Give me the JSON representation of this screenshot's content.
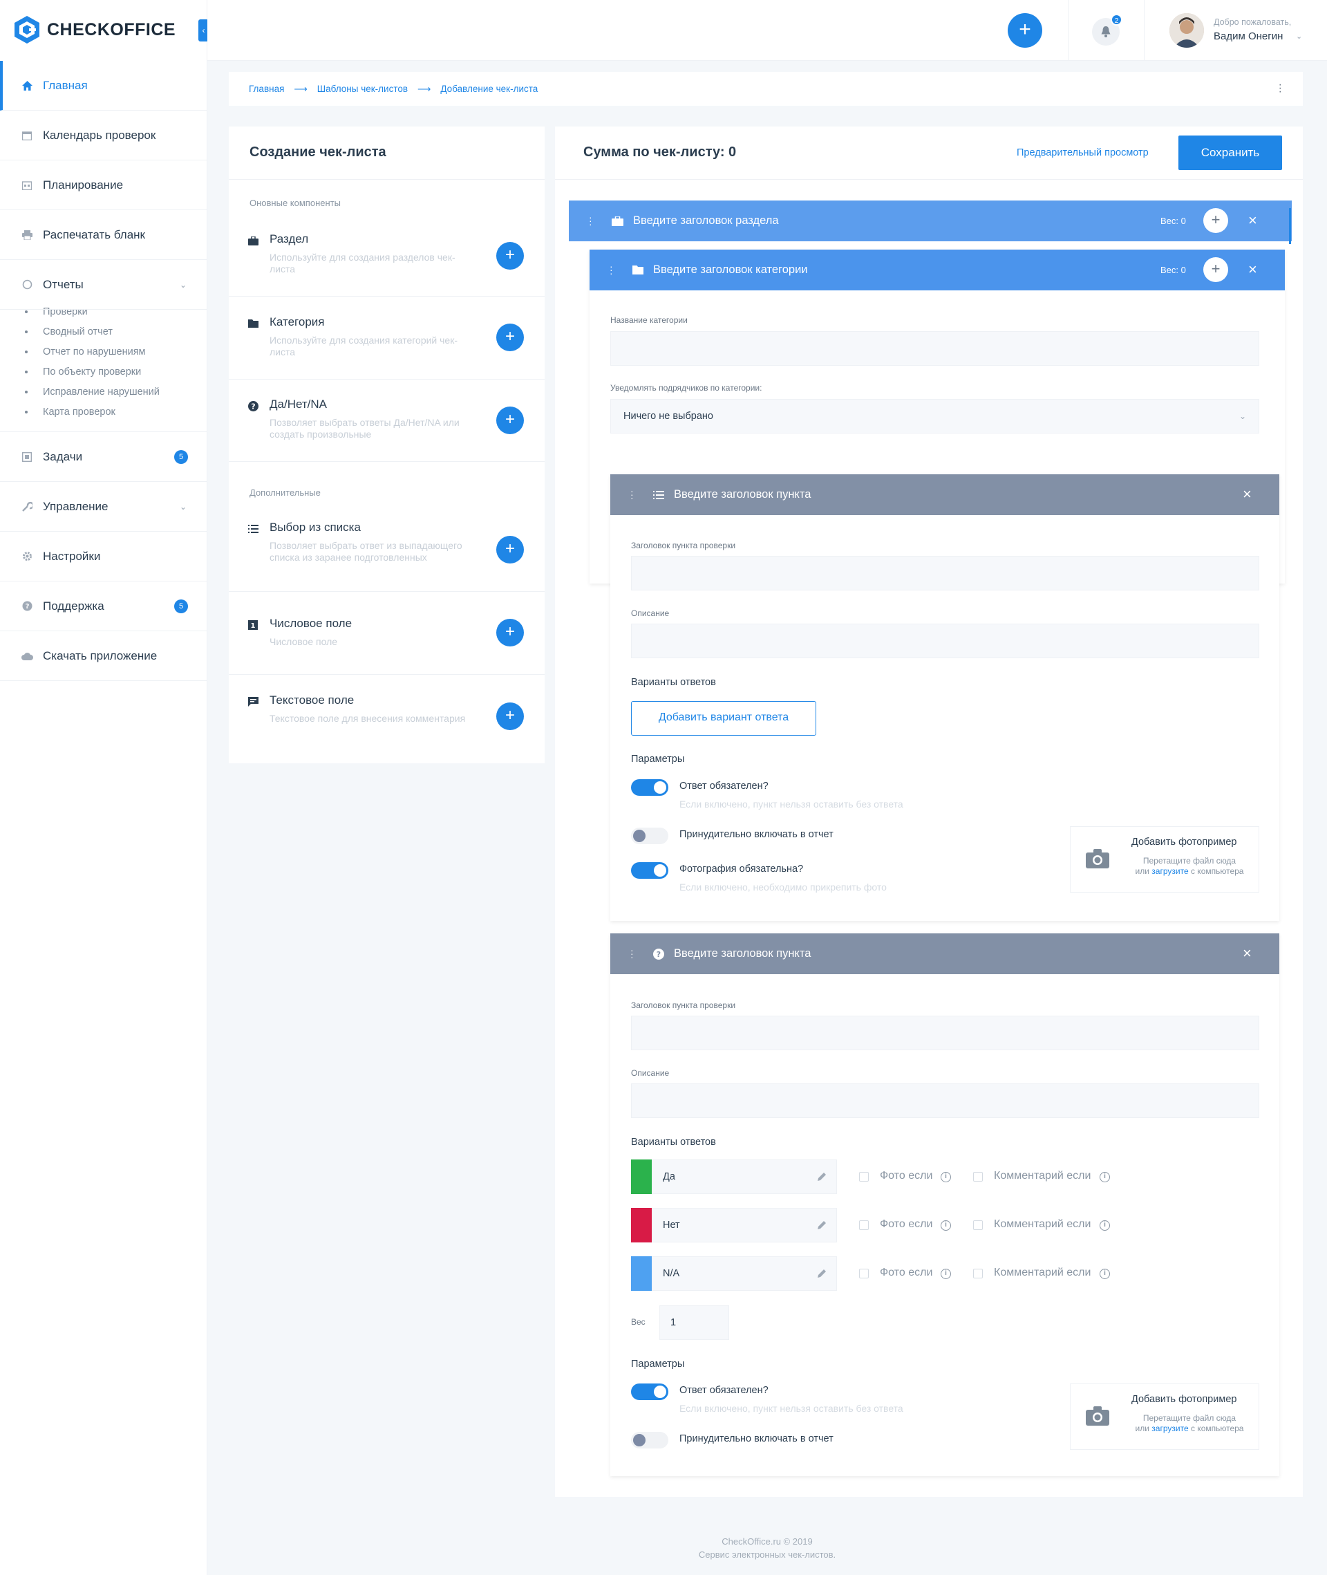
{
  "app": {
    "brand": "CHECKOFFICE"
  },
  "sidebar": {
    "items": [
      {
        "label": "Главная",
        "icon": "home-icon"
      },
      {
        "label": "Календарь проверок",
        "icon": "calendar-icon"
      },
      {
        "label": "Планирование",
        "icon": "planning-icon"
      },
      {
        "label": "Распечатать бланк",
        "icon": "printer-icon"
      },
      {
        "label": "Отчеты",
        "icon": "pie-chart-icon"
      },
      {
        "label": "Задачи",
        "icon": "tasks-icon",
        "badge": "5"
      },
      {
        "label": "Управление",
        "icon": "wrench-icon"
      },
      {
        "label": "Настройки",
        "icon": "gear-icon"
      },
      {
        "label": "Поддержка",
        "icon": "help-icon",
        "badge": "5"
      },
      {
        "label": "Скачать приложение",
        "icon": "cloud-download-icon"
      }
    ],
    "reports_sub": [
      "Проверки",
      "Сводный отчет",
      "Отчет по нарушениям",
      "По объекту проверки",
      "Исправление нарушений",
      "Карта проверок"
    ]
  },
  "header": {
    "notifications_count": "2",
    "welcome": "Добро пожаловать,",
    "user_name": "Вадим Онегин"
  },
  "breadcrumb": [
    "Главная",
    "Шаблоны чек-листов",
    "Добавление чек-листа"
  ],
  "left_panel": {
    "title": "Создание чек-листа",
    "basic_label": "Оновные компоненты",
    "extra_label": "Дополнительные",
    "components": [
      {
        "title": "Раздел",
        "desc": "Используйте для создания разделов чек-листа",
        "icon": "briefcase-icon"
      },
      {
        "title": "Категория",
        "desc": "Используйте для создания категорий чек-листа",
        "icon": "folder-icon"
      },
      {
        "title": "Да/Нет/NA",
        "desc": "Позволяет выбрать ответы Да/Нет/NA или создать произвольные",
        "icon": "question-icon"
      },
      {
        "title": "Выбор из списка",
        "desc": "Позволяет выбрать ответ из выпадающего списка из заранее подготовленных",
        "icon": "list-icon"
      },
      {
        "title": "Числовое поле",
        "desc": "Числовое поле",
        "icon": "number-icon"
      },
      {
        "title": "Текстовое поле",
        "desc": "Текстовое поле для внесения комментария",
        "icon": "comment-icon"
      }
    ]
  },
  "right_panel": {
    "sum_label": "Сумма по чек-листу: 0",
    "preview": "Предварительный просмотр",
    "save": "Сохранить",
    "section": {
      "title": "Введите заголовок раздела",
      "weight": "Вес: 0"
    },
    "category": {
      "title": "Введите заголовок категории",
      "weight": "Вес: 0",
      "name_label": "Название категории",
      "notify_label": "Уведомлять подрядчиков по категории:",
      "notify_value": "Ничего не выбрано"
    },
    "item1": {
      "title": "Введите заголовок пункта",
      "item_title_label": "Заголовок пункта проверки",
      "description_label": "Описание",
      "answers_label": "Варианты ответов",
      "add_answer": "Добавить вариант ответа",
      "params_label": "Параметры",
      "toggles": [
        {
          "label": "Ответ обязателен?",
          "hint": "Если включено, пункт нельзя оставить без ответа",
          "on": true
        },
        {
          "label": "Принудительно включать в отчет",
          "hint": "",
          "on": false
        },
        {
          "label": "Фотография обязательна?",
          "hint": "Если включено, необходимо прикрепить фото",
          "on": true
        }
      ],
      "photo": {
        "title": "Добавить фотопример",
        "line1": "Перетащите файл сюда",
        "or": "или",
        "link": "загрузите",
        "tail": "с компьютера"
      }
    },
    "item2": {
      "title": "Введите заголовок пункта",
      "item_title_label": "Заголовок пункта проверки",
      "description_label": "Описание",
      "answers_label": "Варианты ответов",
      "answers": [
        {
          "value": "Да",
          "color": "#2bb24c"
        },
        {
          "value": "Нет",
          "color": "#d81b46"
        },
        {
          "value": "N/A",
          "color": "#4ea1f1"
        }
      ],
      "photo_if": "Фото если",
      "comment_if": "Комментарий если",
      "weight_label": "Вес",
      "weight_value": "1",
      "params_label": "Параметры",
      "toggles": [
        {
          "label": "Ответ обязателен?",
          "hint": "Если включено, пункт нельзя оставить без ответа",
          "on": true
        },
        {
          "label": "Принудительно включать в отчет",
          "hint": "",
          "on": false
        }
      ],
      "photo": {
        "title": "Добавить фотопример",
        "line1": "Перетащите файл сюда",
        "or": "или",
        "link": "загрузите",
        "tail": "с компьютера"
      }
    }
  },
  "footer": {
    "line1": "CheckOffice.ru © 2019",
    "line2": "Сервис электронных чек-листов."
  },
  "colors": {
    "accent": "#1f86e6",
    "section_bar": "#5c9ded",
    "category_bar": "#4b94ec",
    "item_bar": "#8290a6"
  }
}
